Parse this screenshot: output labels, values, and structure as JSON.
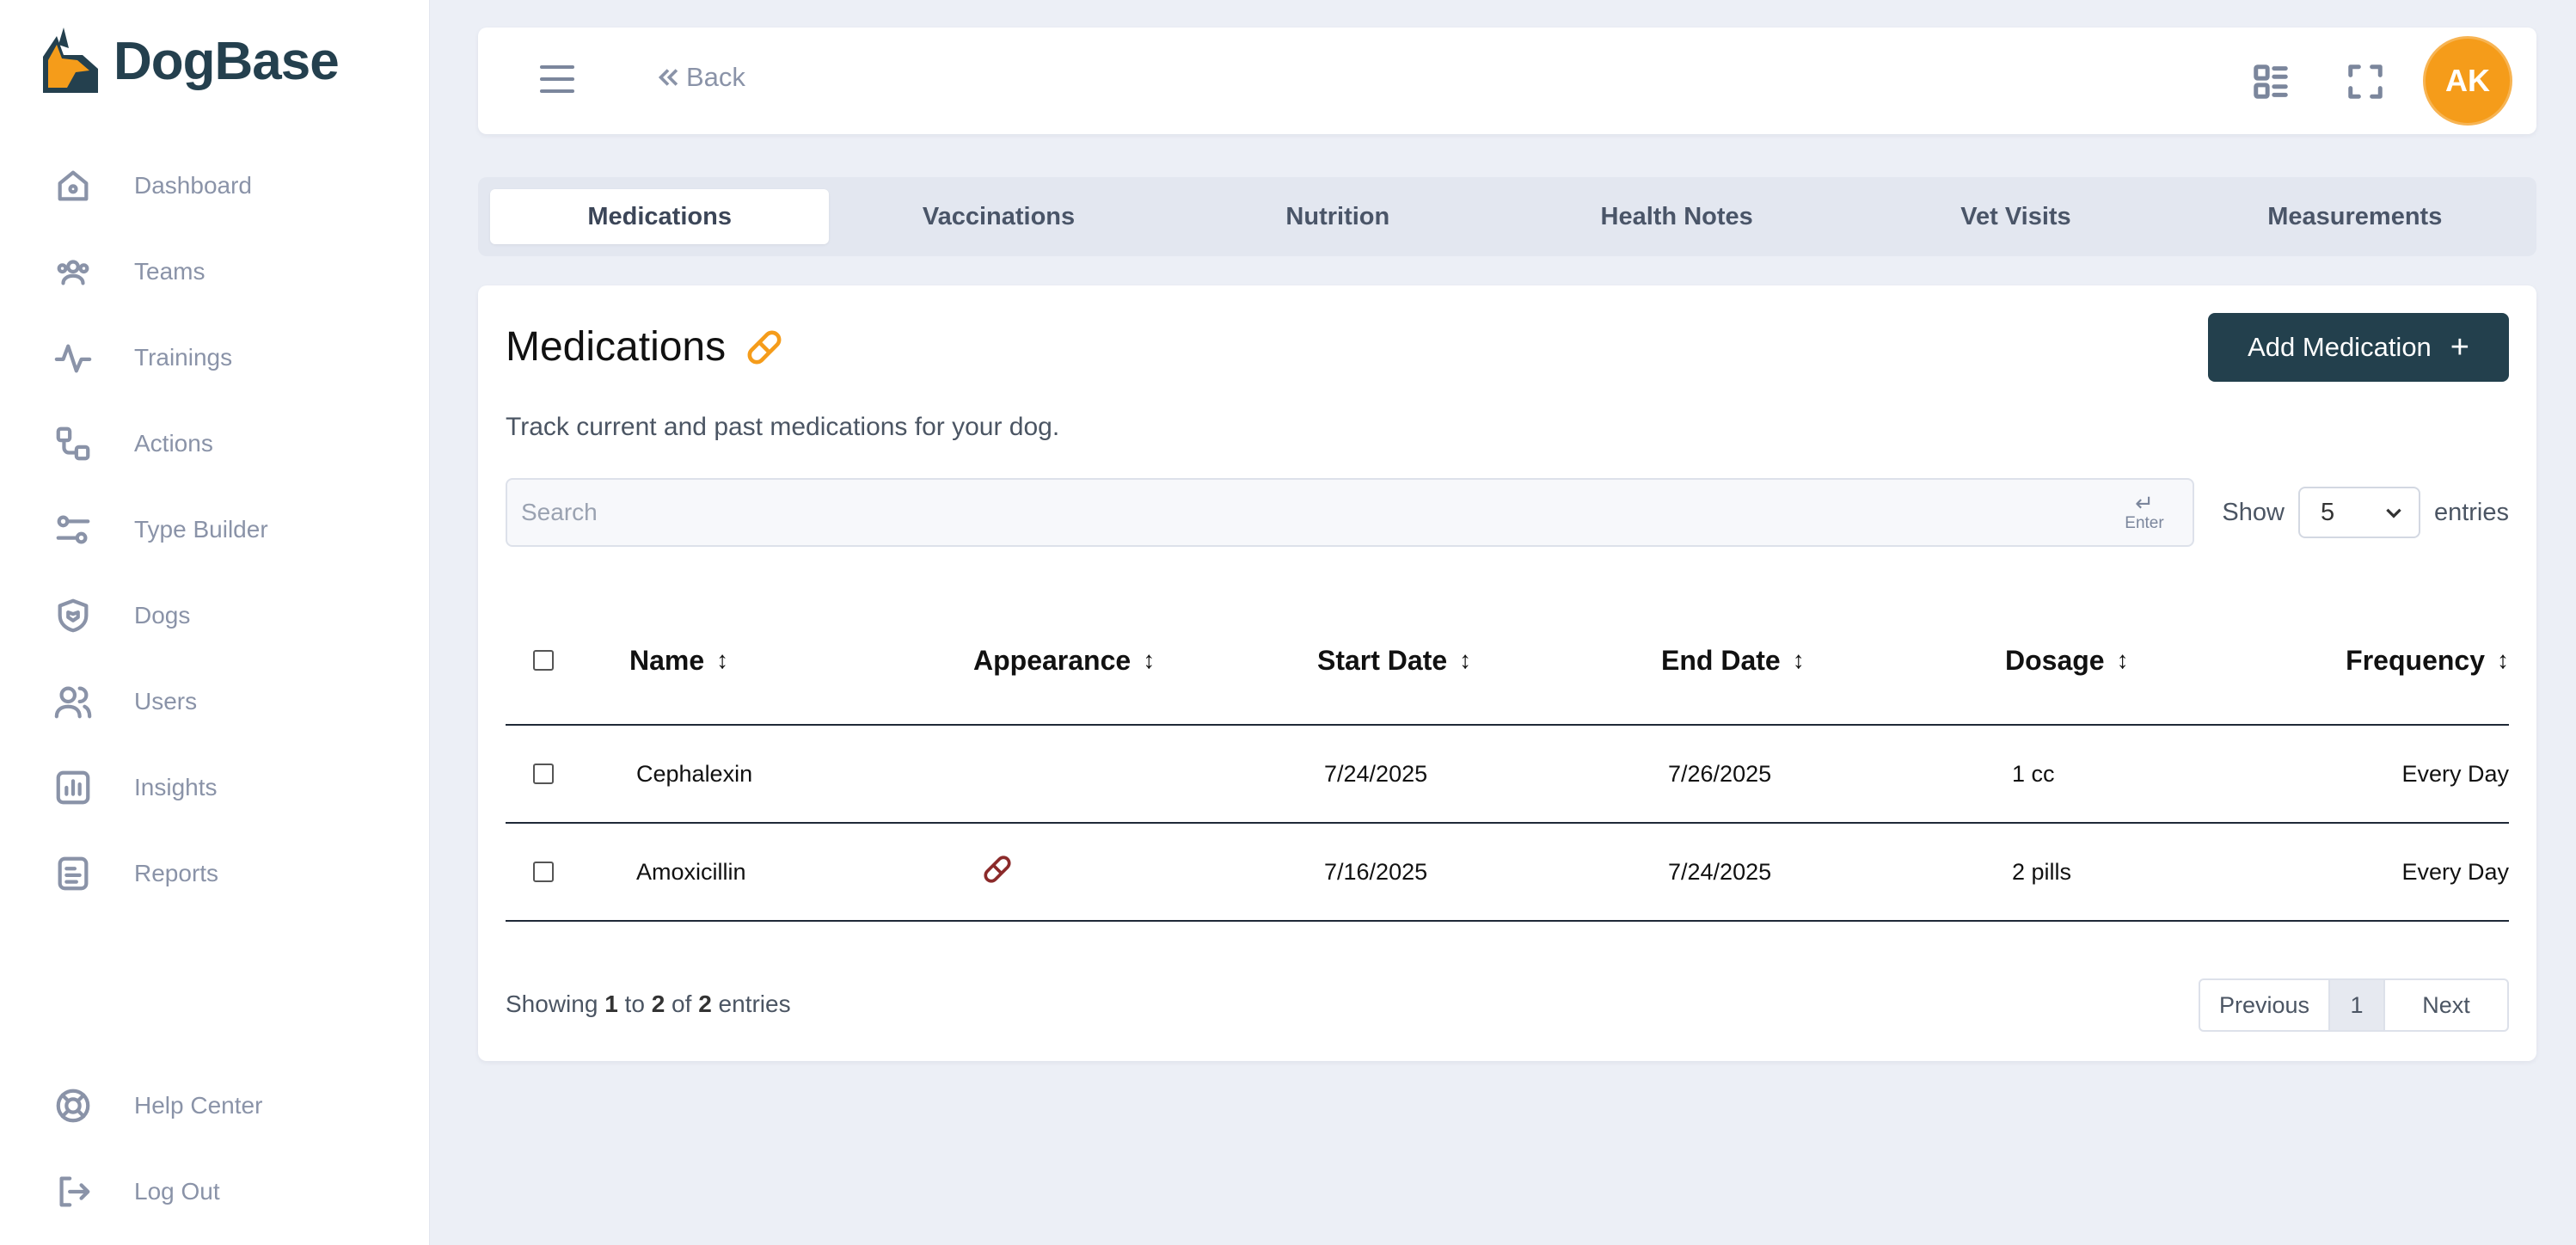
{
  "app": {
    "name": "DogBase",
    "logo_icon": "dog-head-logo"
  },
  "sidebar": {
    "items": [
      {
        "label": "Dashboard",
        "icon": "home-icon"
      },
      {
        "label": "Teams",
        "icon": "teams-icon"
      },
      {
        "label": "Trainings",
        "icon": "activity-icon"
      },
      {
        "label": "Actions",
        "icon": "actions-icon"
      },
      {
        "label": "Type Builder",
        "icon": "sliders-icon"
      },
      {
        "label": "Dogs",
        "icon": "shield-paw-icon"
      },
      {
        "label": "Users",
        "icon": "users-icon"
      },
      {
        "label": "Insights",
        "icon": "chart-icon"
      },
      {
        "label": "Reports",
        "icon": "report-icon"
      }
    ],
    "bottom": [
      {
        "label": "Help Center",
        "icon": "lifebuoy-icon"
      },
      {
        "label": "Log Out",
        "icon": "logout-icon"
      }
    ]
  },
  "topbar": {
    "back_label": "Back",
    "avatar_initials": "AK"
  },
  "tabs": [
    {
      "label": "Medications",
      "active": true
    },
    {
      "label": "Vaccinations"
    },
    {
      "label": "Nutrition"
    },
    {
      "label": "Health Notes"
    },
    {
      "label": "Vet Visits"
    },
    {
      "label": "Measurements"
    }
  ],
  "card": {
    "title": "Medications",
    "add_button_label": "Add Medication",
    "add_button_plus": "+",
    "subtitle": "Track current and past medications for your dog.",
    "search_placeholder": "Search",
    "enter_hint": "Enter",
    "show_label": "Show",
    "entries_value": "5",
    "entries_label": "entries"
  },
  "table": {
    "columns": [
      "Name",
      "Appearance",
      "Start Date",
      "End Date",
      "Dosage",
      "Frequency"
    ],
    "rows": [
      {
        "name": "Cephalexin",
        "appearance": "",
        "start": "7/24/2025",
        "end": "7/26/2025",
        "dosage": "1 cc",
        "frequency": "Every Day"
      },
      {
        "name": "Amoxicillin",
        "appearance": "pill-icon",
        "start": "7/16/2025",
        "end": "7/24/2025",
        "dosage": "2 pills",
        "frequency": "Every Day"
      }
    ]
  },
  "footer": {
    "showing_prefix": "Showing",
    "from": "1",
    "to_word": "to",
    "to": "2",
    "of_word": "of",
    "total": "2",
    "suffix": "entries",
    "prev_label": "Previous",
    "page": "1",
    "next_label": "Next"
  },
  "colors": {
    "brand_dark": "#23404d",
    "accent_orange": "#f59c1a",
    "pill_red": "#8b2a2a",
    "background": "#eceff6"
  }
}
